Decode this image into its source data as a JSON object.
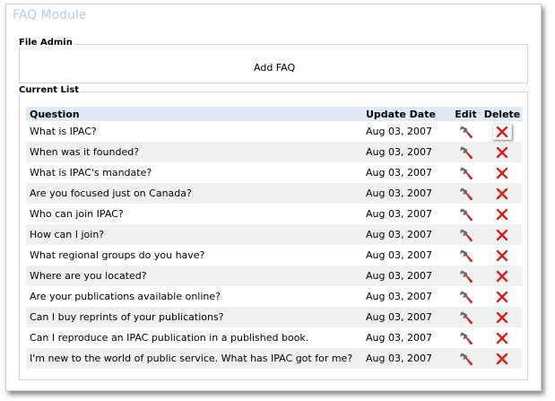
{
  "module": {
    "title": "FAQ Module"
  },
  "file_admin": {
    "legend": "File Admin",
    "add_label": "Add FAQ"
  },
  "current_list": {
    "legend": "Current List",
    "headers": {
      "question": "Question",
      "update_date": "Update Date",
      "edit": "Edit",
      "delete": "Delete"
    },
    "rows": [
      {
        "question": "What is IPAC?",
        "date": "Aug 03, 2007"
      },
      {
        "question": "When was it founded?",
        "date": "Aug 03, 2007"
      },
      {
        "question": "What is IPAC's mandate?",
        "date": "Aug 03, 2007"
      },
      {
        "question": "Are you focused just on Canada?",
        "date": "Aug 03, 2007"
      },
      {
        "question": "Who can join IPAC?",
        "date": "Aug 03, 2007"
      },
      {
        "question": "How can I join?",
        "date": "Aug 03, 2007"
      },
      {
        "question": "What regional groups do you have?",
        "date": "Aug 03, 2007"
      },
      {
        "question": "Where are you located?",
        "date": "Aug 03, 2007"
      },
      {
        "question": "Are your publications available online?",
        "date": "Aug 03, 2007"
      },
      {
        "question": "Can I buy reprints of your publications?",
        "date": "Aug 03, 2007"
      },
      {
        "question": "Can I reproduce an IPAC publication in a published book.",
        "date": "Aug 03, 2007"
      },
      {
        "question": "I'm new to the world of public service. What has IPAC got for me?",
        "date": "Aug 03, 2007"
      }
    ]
  },
  "colors": {
    "title": "#b7cfe6",
    "header_bg": "#dfeaf6",
    "row_alt": "#f0f0f0",
    "delete_red": "#d42020",
    "wrench_gray": "#6a6a6a",
    "wrench_red": "#c62828"
  },
  "icons": {
    "edit": "wrench-icon",
    "delete": "delete-x-icon"
  }
}
